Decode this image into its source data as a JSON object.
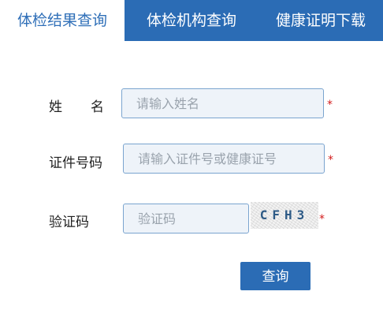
{
  "tabs": [
    {
      "label": "体检结果查询",
      "active": true
    },
    {
      "label": "体检机构查询",
      "active": false
    },
    {
      "label": "健康证明下载",
      "active": false
    }
  ],
  "form": {
    "name": {
      "label_first": "姓",
      "label_last": "名",
      "placeholder": "请输入姓名",
      "required_mark": "*"
    },
    "id_number": {
      "label": "证件号码",
      "placeholder": "请输入证件号或健康证号",
      "required_mark": "*"
    },
    "captcha": {
      "label": "验证码",
      "placeholder": "验证码",
      "image_text": "CFH3",
      "required_mark": "*"
    },
    "submit_label": "查询"
  },
  "colors": {
    "tab_active_text": "#2f6fb8",
    "tab_inactive_bg": "#2b6cb5",
    "button_bg": "#2b6cb5",
    "input_bg": "#eef3f9",
    "input_border": "#7aa4cf",
    "required": "#d21a1a"
  }
}
